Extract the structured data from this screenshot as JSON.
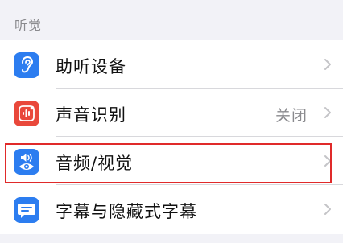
{
  "section": {
    "header": "听觉"
  },
  "rows": [
    {
      "label": "助听设备",
      "value": "",
      "icon": "ear-icon",
      "color": "#2c7df0"
    },
    {
      "label": "声音识别",
      "value": "关闭",
      "icon": "waveform-icon",
      "color": "#e9483b"
    },
    {
      "label": "音频/视觉",
      "value": "",
      "icon": "speaker-eye-icon",
      "color": "#2c7df0",
      "highlighted": true
    },
    {
      "label": "字幕与隐藏式字幕",
      "value": "",
      "icon": "caption-icon",
      "color": "#2c7df0"
    }
  ],
  "highlight_color": "#e02a2a"
}
